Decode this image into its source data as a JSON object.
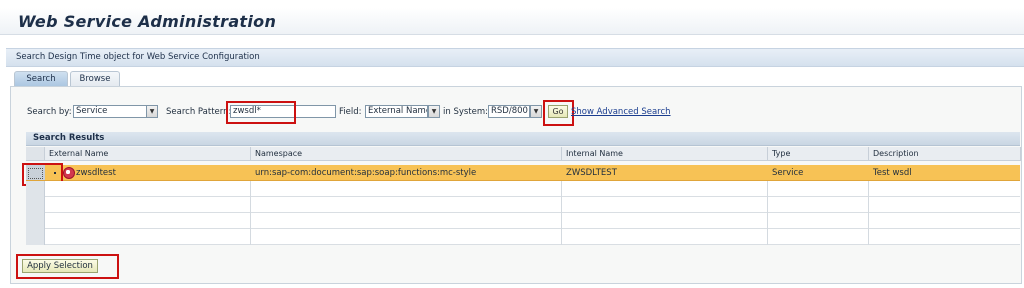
{
  "header": {
    "title": "Web Service Administration"
  },
  "section": {
    "title": "Search Design Time object for Web Service Configuration"
  },
  "tabs": [
    {
      "label": "Search",
      "active": true
    },
    {
      "label": "Browse",
      "active": false
    }
  ],
  "search": {
    "search_by_label": "Search by:",
    "search_by_value": "Service",
    "pattern_label": "Search Pattern:",
    "pattern_value": "zwsdl*",
    "field_label": "Field:",
    "field_value": "External Name",
    "system_label": "in System:",
    "system_value": "RSD/800",
    "go_label": "Go",
    "advanced_link": "Show Advanced Search"
  },
  "results": {
    "title": "Search Results",
    "columns": [
      "External Name",
      "Namespace",
      "Internal Name",
      "Type",
      "Description"
    ],
    "rows": [
      {
        "external_name": "zwsdltest",
        "namespace": "urn:sap-com:document:sap:soap:functions:mc-style",
        "internal_name": "ZWSDLTEST",
        "type": "Service",
        "description": "Test wsdl",
        "selected": true,
        "icon": "web-service-icon"
      }
    ]
  },
  "footer": {
    "apply_label": "Apply Selection"
  },
  "colors": {
    "highlight_row": "#f7c255",
    "annotation_box": "#cc1111",
    "header_blue": "#c9d6e3"
  }
}
